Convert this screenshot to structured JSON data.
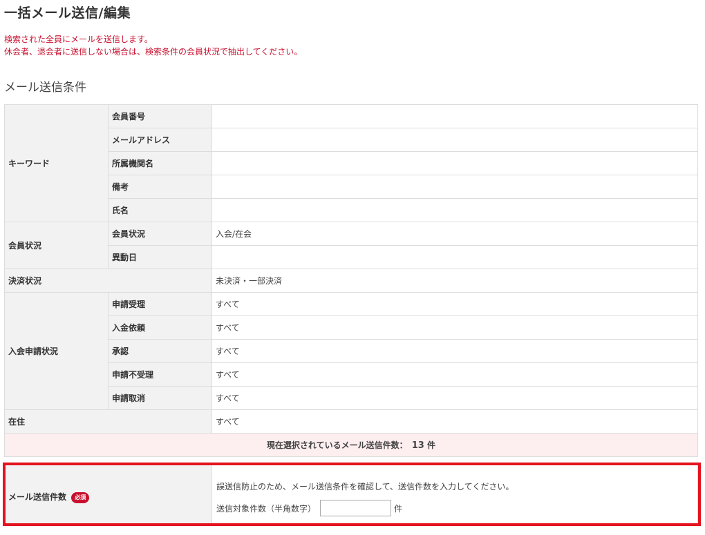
{
  "page": {
    "title": "一括メール送信/編集",
    "notice": [
      "検索された全員にメールを送信します。",
      "休会者、退会者に送信しない場合は、検索条件の会員状況で抽出してください。"
    ]
  },
  "section": {
    "title": "メール送信条件"
  },
  "conditions": {
    "keyword": {
      "label": "キーワード",
      "fields": [
        {
          "label": "会員番号",
          "value": ""
        },
        {
          "label": "メールアドレス",
          "value": ""
        },
        {
          "label": "所属機関名",
          "value": ""
        },
        {
          "label": "備考",
          "value": ""
        },
        {
          "label": "氏名",
          "value": ""
        }
      ]
    },
    "member_status": {
      "label": "会員状況",
      "fields": [
        {
          "label": "会員状況",
          "value": "入会/在会"
        },
        {
          "label": "異動日",
          "value": ""
        }
      ]
    },
    "payment": {
      "label": "決済状況",
      "value": "未決済・一部決済"
    },
    "application": {
      "label": "入会申請状況",
      "fields": [
        {
          "label": "申請受理",
          "value": "すべて"
        },
        {
          "label": "入金依頼",
          "value": "すべて"
        },
        {
          "label": "承認",
          "value": "すべて"
        },
        {
          "label": "申請不受理",
          "value": "すべて"
        },
        {
          "label": "申請取消",
          "value": "すべて"
        }
      ]
    },
    "residence": {
      "label": "在住",
      "value": "すべて"
    }
  },
  "selection": {
    "prefix": "現在選択されているメール送信件数：",
    "count": "13",
    "unit": "件"
  },
  "send_count": {
    "label": "メール送信件数",
    "required": "必須",
    "message": "誤送信防止のため、メール送信条件を確認して、送信件数を入力してください。",
    "input_label": "送信対象件数（半角数字）",
    "input_value": "",
    "unit": "件"
  },
  "colors": {
    "accent": "#c8102e",
    "highlight_border": "#e3141f",
    "header_bg": "#f2f2f2",
    "count_row_bg": "#fdeef0"
  }
}
